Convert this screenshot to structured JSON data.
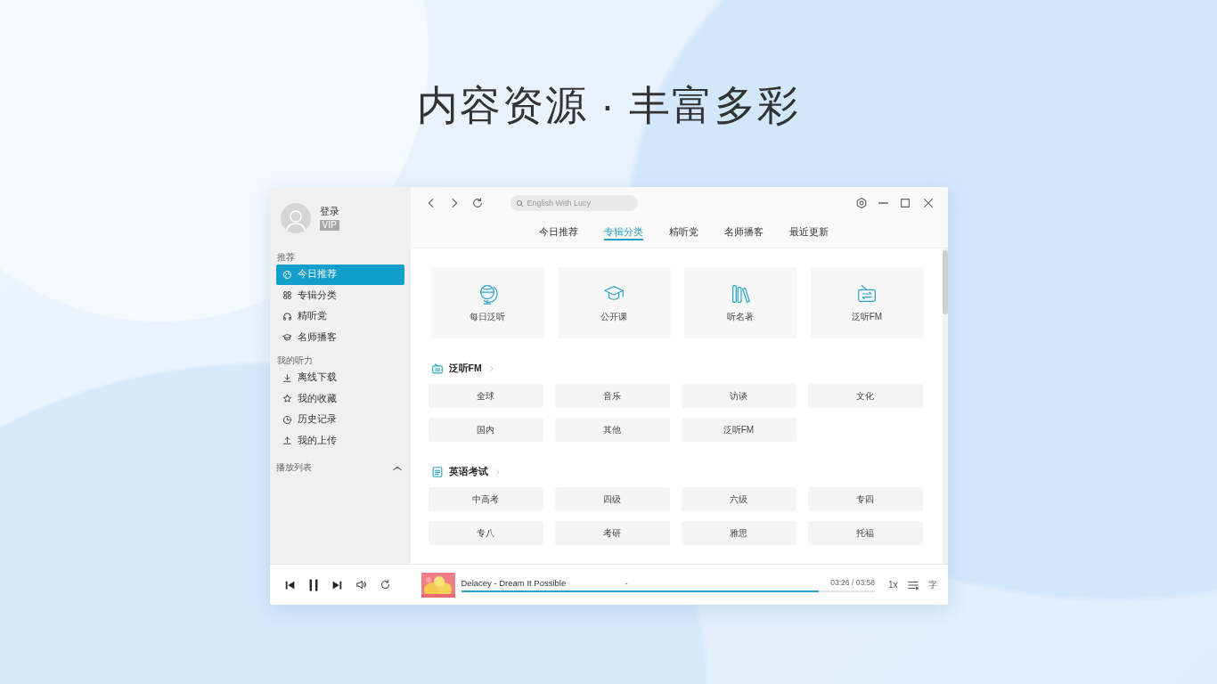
{
  "headline": "内容资源 · 丰富多彩",
  "user": {
    "name": "登录",
    "badge": "VIP"
  },
  "sidebar": {
    "sections": [
      {
        "title": "推荐",
        "items": [
          {
            "label": "今日推荐",
            "selected": true
          },
          {
            "label": "专辑分类",
            "selected": false
          },
          {
            "label": "精听党",
            "selected": false
          },
          {
            "label": "名师播客",
            "selected": false
          }
        ]
      },
      {
        "title": "我的听力",
        "items": [
          {
            "label": "离线下载",
            "selected": false
          },
          {
            "label": "我的收藏",
            "selected": false
          },
          {
            "label": "历史记录",
            "selected": false
          },
          {
            "label": "我的上传",
            "selected": false
          }
        ]
      }
    ],
    "playlist": {
      "label": "播放列表"
    }
  },
  "search": {
    "placeholder": "English With Lucy"
  },
  "tabs": [
    {
      "label": "今日推荐",
      "selected": false
    },
    {
      "label": "专辑分类",
      "selected": true
    },
    {
      "label": "精听党",
      "selected": false
    },
    {
      "label": "名师播客",
      "selected": false
    },
    {
      "label": "最近更新",
      "selected": false
    }
  ],
  "categories": [
    {
      "label": "每日泛听"
    },
    {
      "label": "公开课"
    },
    {
      "label": "听名著"
    },
    {
      "label": "泛听FM"
    }
  ],
  "sections": [
    {
      "title": "泛听FM",
      "chips": [
        "全球",
        "音乐",
        "访谈",
        "文化",
        "国内",
        "其他",
        "泛听FM"
      ]
    },
    {
      "title": "英语考试",
      "chips": [
        "中高考",
        "四级",
        "六级",
        "专四",
        "专八",
        "考研",
        "雅思",
        "托福"
      ]
    }
  ],
  "player": {
    "playing": true,
    "track": "Delacey - Dream It Possible",
    "separator": "-",
    "time": "03:26 / 03:58",
    "level": 0.865,
    "speed": "1x",
    "lyrics": "字"
  }
}
